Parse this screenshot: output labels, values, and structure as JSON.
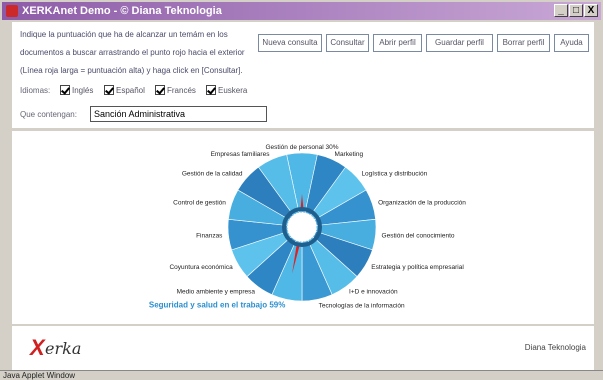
{
  "window": {
    "title": "XERKAnet Demo - © Diana Teknologia",
    "minimize": "_",
    "maximize": "□",
    "close": "X"
  },
  "instructions": {
    "line1": "Indique la puntuación que ha de alcanzar un temám en los",
    "line2": "documentos a buscar arrastrando el punto rojo hacia el exterior",
    "line3": "(Línea roja larga = puntuación alta) y haga click en [Consultar]."
  },
  "toolbar": {
    "nueva_consulta": "Nueva consulta",
    "consultar": "Consultar",
    "abrir_perfil": "Abrir perfil",
    "guardar_perfil": "Guardar perfil",
    "borrar_perfil": "Borrar perfil",
    "ayuda": "Ayuda"
  },
  "languages": {
    "label": "Idiomas:",
    "items": [
      {
        "name": "Inglés",
        "checked": true
      },
      {
        "name": "Español",
        "checked": true
      },
      {
        "name": "Francés",
        "checked": true
      },
      {
        "name": "Euskera",
        "checked": true
      }
    ]
  },
  "search": {
    "label": "Que contengan:",
    "value": "Sanción Administrativa"
  },
  "wheel": {
    "highlight_color": "#2a8fcf",
    "needle_color": "#e02020",
    "ring_color": "#1e5f8e",
    "segment_colors": [
      "#4fb8e6",
      "#2e86c4",
      "#5ec3ec",
      "#3592cf",
      "#48aee0",
      "#2c7fbc",
      "#56bde8",
      "#3a98d2"
    ],
    "topics": [
      {
        "label": "Gestión de personal 30%",
        "score": 30,
        "highlight": false
      },
      {
        "label": "Marketing",
        "score": 0,
        "highlight": false
      },
      {
        "label": "Logística y distribución",
        "score": 0,
        "highlight": false
      },
      {
        "label": "Organización de la producción",
        "score": 0,
        "highlight": false
      },
      {
        "label": "Gestión del conocimiento",
        "score": 0,
        "highlight": false
      },
      {
        "label": "Estrategia y política empresarial",
        "score": 0,
        "highlight": false
      },
      {
        "label": "I+D e innovación",
        "score": 0,
        "highlight": false
      },
      {
        "label": "Tecnologías de la información",
        "score": 0,
        "highlight": false
      },
      {
        "label": "Seguridad y salud en el trabajo 59%",
        "score": 59,
        "highlight": true
      },
      {
        "label": "Medio ambiente y empresa",
        "score": 0,
        "highlight": false
      },
      {
        "label": "Coyuntura económica",
        "score": 0,
        "highlight": false
      },
      {
        "label": "Finanzas",
        "score": 0,
        "highlight": false
      },
      {
        "label": "Control de gestión",
        "score": 0,
        "highlight": false
      },
      {
        "label": "Gestión de la calidad",
        "score": 0,
        "highlight": false
      },
      {
        "label": "Empresas familiares",
        "score": 0,
        "highlight": false
      }
    ]
  },
  "footer": {
    "logo_mark": "X",
    "logo_text": "erka",
    "company": "Diana Teknologia"
  },
  "status": {
    "text": "Java Applet Window"
  }
}
